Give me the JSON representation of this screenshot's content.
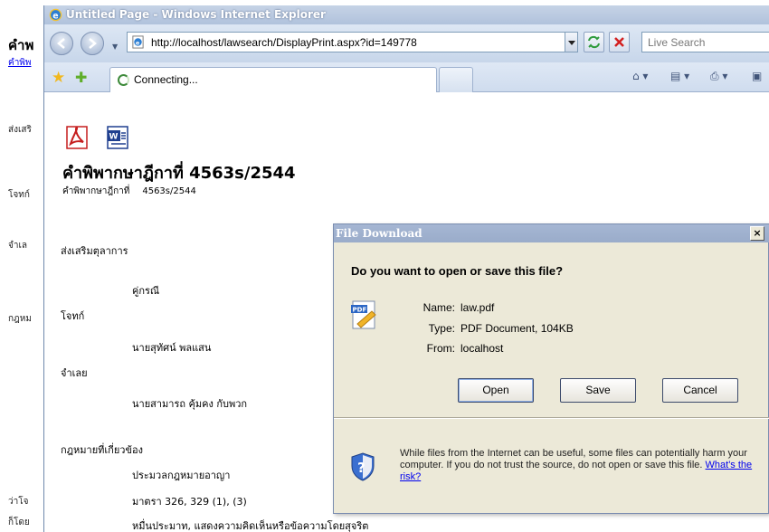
{
  "background_page": {
    "title": "คำพ",
    "subtitle": "คำพิพ",
    "lines": [
      "ส่งเสริ",
      "โจทก์",
      "จำเล",
      "กฎหม",
      "ว่าโจ",
      "ก็โดย"
    ]
  },
  "window": {
    "title": "Untitled Page - Windows Internet Explorer",
    "address": "http://localhost/lawsearch/DisplayPrint.aspx?id=149778",
    "search_placeholder": "Live Search",
    "tab_label": "Connecting..."
  },
  "content": {
    "title": "คำพิพากษาฎีกาที่ 4563s/2544",
    "subtitle_label": "คำพิพากษาฎีกาที่",
    "subtitle_number": "4563s/2544",
    "lines": [
      "ส่งเสริมตุลาการ",
      "คู่กรณี",
      "โจทก์",
      "นายสุทัศน์ พลแสน",
      "จำเลย",
      "นายสามารถ คุ้มคง กับพวก",
      "กฎหมายที่เกี่ยวข้อง",
      "ประมวลกฎหมายอาญา",
      "มาตรา 326, 329 (1), (3)",
      "หมื่นประมาท, แสดงความคิดเห็นหรือข้อความโดยสุจริต"
    ]
  },
  "dialog": {
    "title": "File Download",
    "question": "Do you want to open or save this file?",
    "name_label": "Name:",
    "name_value": "law.pdf",
    "type_label": "Type:",
    "type_value": "PDF Document, 104KB",
    "from_label": "From:",
    "from_value": "localhost",
    "open_label": "Open",
    "save_label": "Save",
    "cancel_label": "Cancel",
    "close_label": "×",
    "warning": "While files from the Internet can be useful, some files can potentially harm your computer. If you do not trust the source, do not open or save this file.",
    "risk_link": "What's the risk?"
  }
}
